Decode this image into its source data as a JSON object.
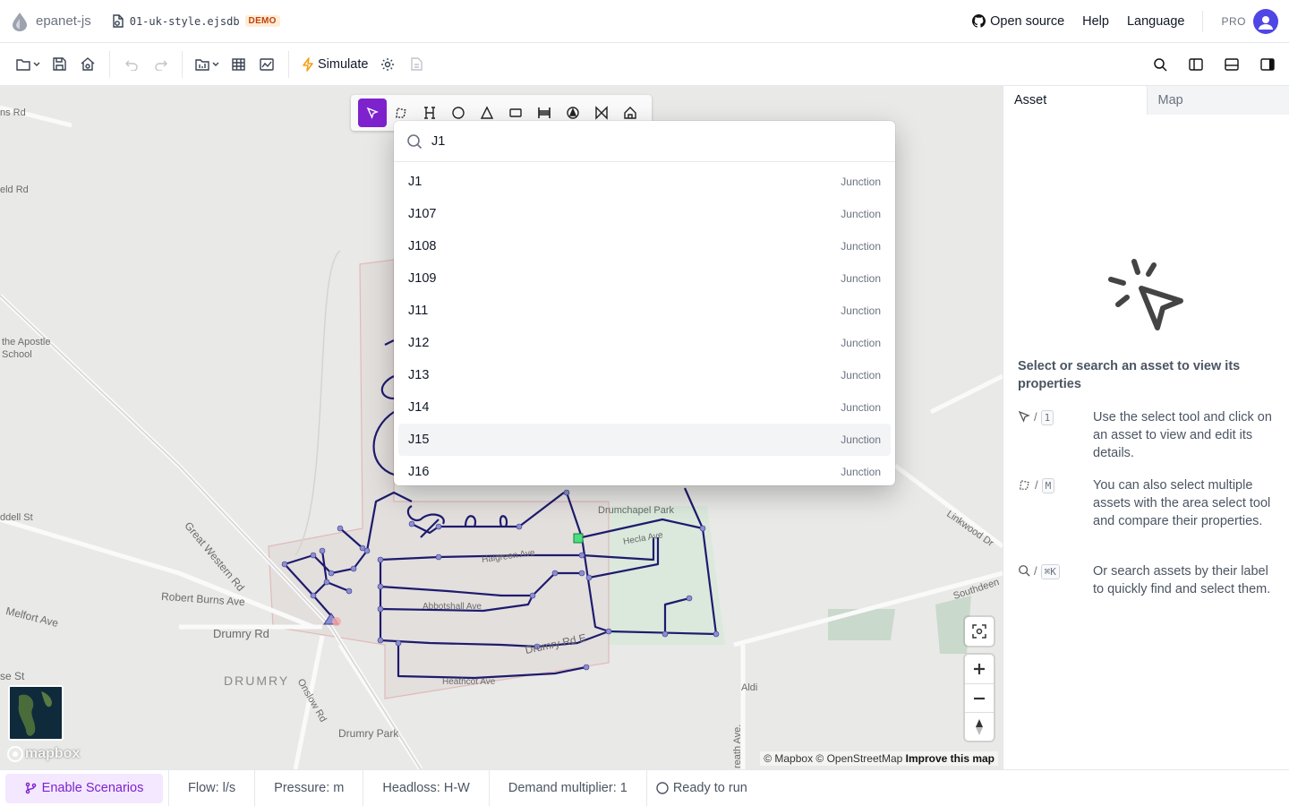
{
  "app": {
    "name": "epanet-js",
    "file_name": "01-uk-style.ejsdb",
    "badge": "DEMO"
  },
  "header": {
    "open_source": "Open source",
    "help": "Help",
    "language": "Language",
    "pro": "PRO"
  },
  "toolbar": {
    "simulate": "Simulate"
  },
  "search": {
    "query": "J1",
    "highlighted_index": 8,
    "results": [
      {
        "label": "J1",
        "type": "Junction"
      },
      {
        "label": "J107",
        "type": "Junction"
      },
      {
        "label": "J108",
        "type": "Junction"
      },
      {
        "label": "J109",
        "type": "Junction"
      },
      {
        "label": "J11",
        "type": "Junction"
      },
      {
        "label": "J12",
        "type": "Junction"
      },
      {
        "label": "J13",
        "type": "Junction"
      },
      {
        "label": "J14",
        "type": "Junction"
      },
      {
        "label": "J15",
        "type": "Junction"
      },
      {
        "label": "J16",
        "type": "Junction"
      }
    ]
  },
  "map": {
    "labels": {
      "ns_rd": "ns Rd",
      "eld_rd": "eld Rd",
      "apostle_1": "the Apostle",
      "apostle_2": "School",
      "dell_st": "ddell St",
      "great_western": "Great Western Rd",
      "robert_burns": "Robert Burns Ave",
      "melfort": "Melfort Ave",
      "drumry_rd": "Drumry Rd",
      "drumry": "DRUMRY",
      "onslow": "Onslow Rd",
      "se_st": "se St",
      "drumry_park": "Drumry Park",
      "drumchapel_park": "Drumchapel Park",
      "hecla": "Hecla Ave",
      "halgreen": "Halgreen Ave",
      "abbotshall": "Abbotshall Ave",
      "drumry_rd_e": "Drumry Rd E",
      "heathcot": "Heathcot Ave",
      "linkwood": "Linkwood Dr",
      "southdeen": "Southdeen",
      "aldi": "Aldi",
      "reath": "reath Ave."
    },
    "logo": "mapbox",
    "attribution": "© Mapbox © OpenStreetMap",
    "improve": "Improve this map"
  },
  "panel": {
    "tabs": [
      "Asset",
      "Map"
    ],
    "empty_title": "Select or search an asset to view its properties",
    "tips": [
      {
        "key": "1",
        "text": "Use the select tool and click on an asset to view and edit its details."
      },
      {
        "key": "M",
        "text": "You can also select multiple assets with the area select tool and compare their properties."
      },
      {
        "key": "⌘K",
        "text": "Or search assets by their label to quickly find and select them."
      }
    ],
    "separator": "/"
  },
  "footer": {
    "enable_scenarios": "Enable Scenarios",
    "flow": "Flow: l/s",
    "pressure": "Pressure: m",
    "headloss": "Headloss: H-W",
    "demand": "Demand multiplier: 1",
    "status": "Ready to run"
  }
}
